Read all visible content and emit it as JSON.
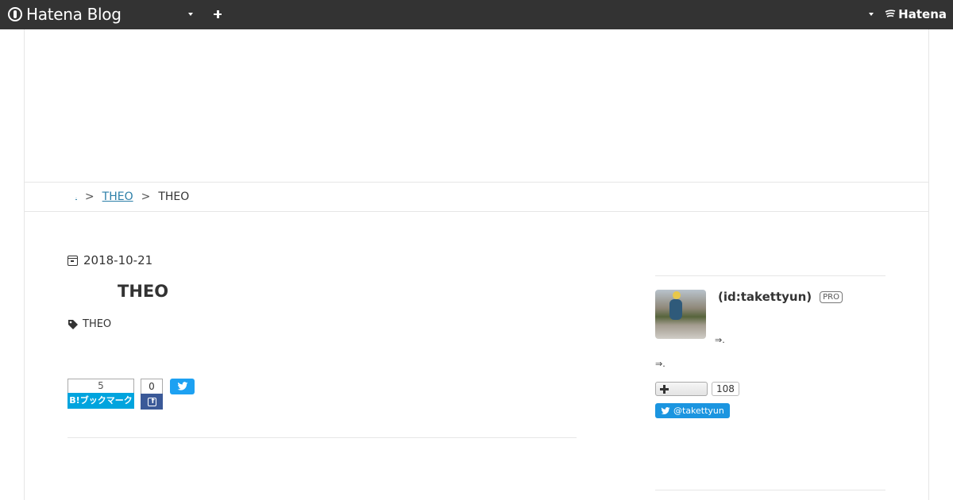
{
  "topbar": {
    "brand": "Hatena Blog",
    "hatena_label": "Hatena"
  },
  "breadcrumb": {
    "home": ".",
    "separator": ">",
    "category": "THEO",
    "current": "THEO"
  },
  "entry": {
    "date": "2018-10-21",
    "title": "THEO",
    "category": "THEO",
    "share": {
      "hatena_count": "5",
      "hatena_label": "B!ブックマーク",
      "facebook_count": "0"
    }
  },
  "sidebar": {
    "profile_id": "(id:takettyun)",
    "pro_badge": "PRO",
    "arrow_link_1": "⇒.",
    "arrow_link_2": "⇒.",
    "subscriber_count": "108",
    "twitter_follow": "@takettyun"
  },
  "colors": {
    "topbar": "#333333",
    "link": "#2c7fa8",
    "hatena_bookmark": "#00a4de",
    "facebook": "#3b5998",
    "twitter": "#1da1f2"
  }
}
